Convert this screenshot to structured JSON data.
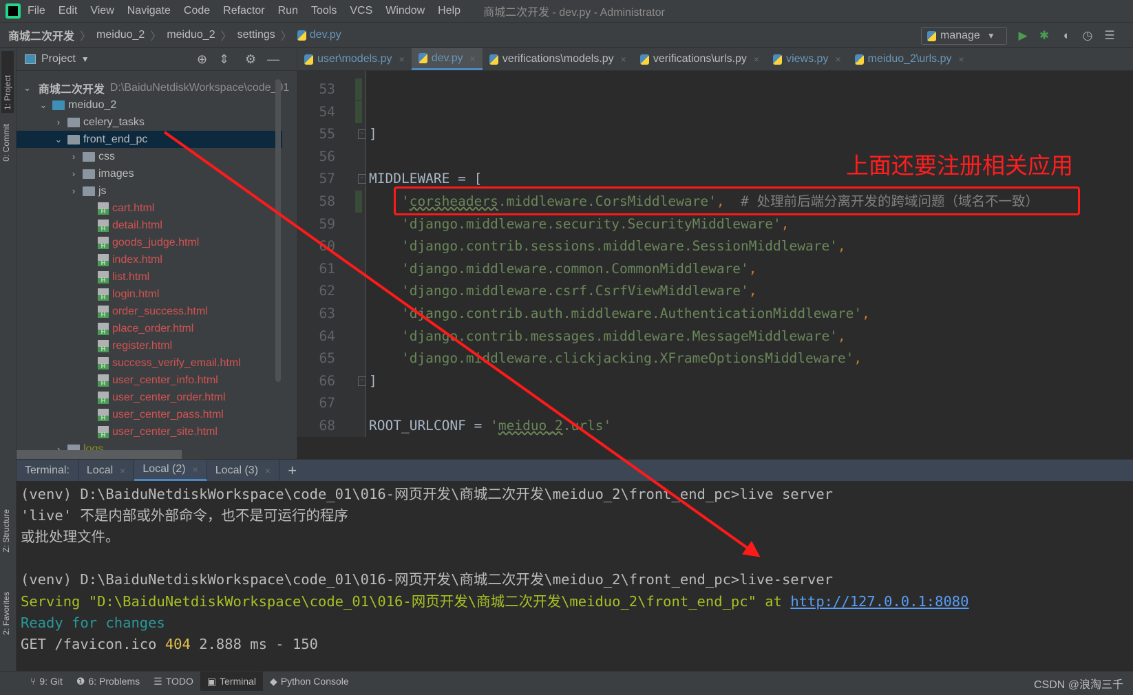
{
  "window": {
    "title": "商城二次开发 - dev.py - Administrator"
  },
  "menu": [
    "File",
    "Edit",
    "View",
    "Navigate",
    "Code",
    "Refactor",
    "Run",
    "Tools",
    "VCS",
    "Window",
    "Help"
  ],
  "breadcrumb": [
    "商城二次开发",
    "meiduo_2",
    "meiduo_2",
    "settings",
    "dev.py"
  ],
  "run_config": {
    "label": "manage",
    "icons": [
      "run-icon",
      "debug-icon",
      "coverage-icon",
      "profile-icon",
      "build-icon"
    ]
  },
  "left_strip": [
    "1: Project",
    "0: Commit",
    "Z: Structure",
    "2: Favorites"
  ],
  "project": {
    "header": "Project",
    "tree": [
      {
        "label": "商城二次开发",
        "suffix": "D:\\BaiduNetdiskWorkspace\\code_01",
        "depth": 0,
        "kind": "folder",
        "expanded": true,
        "color": "#bbbbbb"
      },
      {
        "label": "meiduo_2",
        "depth": 1,
        "kind": "folder-blue",
        "expanded": true,
        "color": "#bbbbbb"
      },
      {
        "label": "celery_tasks",
        "depth": 2,
        "kind": "folder",
        "expanded": false,
        "color": "#bbbbbb"
      },
      {
        "label": "front_end_pc",
        "depth": 2,
        "kind": "folder",
        "expanded": true,
        "color": "#bbbbbb",
        "selected": true
      },
      {
        "label": "css",
        "depth": 3,
        "kind": "folder",
        "expanded": false,
        "color": "#bbbbbb"
      },
      {
        "label": "images",
        "depth": 3,
        "kind": "folder",
        "expanded": false,
        "color": "#bbbbbb"
      },
      {
        "label": "js",
        "depth": 3,
        "kind": "folder",
        "expanded": false,
        "color": "#bbbbbb"
      },
      {
        "label": "cart.html",
        "depth": 4,
        "kind": "html",
        "color": "#d25252"
      },
      {
        "label": "detail.html",
        "depth": 4,
        "kind": "html",
        "color": "#d25252"
      },
      {
        "label": "goods_judge.html",
        "depth": 4,
        "kind": "html",
        "color": "#d25252"
      },
      {
        "label": "index.html",
        "depth": 4,
        "kind": "html",
        "color": "#d25252"
      },
      {
        "label": "list.html",
        "depth": 4,
        "kind": "html",
        "color": "#d25252"
      },
      {
        "label": "login.html",
        "depth": 4,
        "kind": "html",
        "color": "#d25252"
      },
      {
        "label": "order_success.html",
        "depth": 4,
        "kind": "html",
        "color": "#d25252"
      },
      {
        "label": "place_order.html",
        "depth": 4,
        "kind": "html",
        "color": "#d25252"
      },
      {
        "label": "register.html",
        "depth": 4,
        "kind": "html",
        "color": "#d25252"
      },
      {
        "label": "success_verify_email.html",
        "depth": 4,
        "kind": "html",
        "color": "#d25252"
      },
      {
        "label": "user_center_info.html",
        "depth": 4,
        "kind": "html",
        "color": "#d25252"
      },
      {
        "label": "user_center_order.html",
        "depth": 4,
        "kind": "html",
        "color": "#d25252"
      },
      {
        "label": "user_center_pass.html",
        "depth": 4,
        "kind": "html",
        "color": "#d25252"
      },
      {
        "label": "user_center_site.html",
        "depth": 4,
        "kind": "html",
        "color": "#d25252"
      },
      {
        "label": "logs",
        "depth": 2,
        "kind": "folder",
        "expanded": false,
        "color": "#8c8c1a"
      }
    ]
  },
  "editor_tabs": [
    {
      "label": "user\\models.py",
      "blue": true
    },
    {
      "label": "dev.py",
      "blue": true,
      "active": true
    },
    {
      "label": "verifications\\models.py"
    },
    {
      "label": "verifications\\urls.py"
    },
    {
      "label": "views.py",
      "blue": true
    },
    {
      "label": "meiduo_2\\urls.py",
      "blue": true
    }
  ],
  "code": [
    {
      "n": "53",
      "tokens": [],
      "changed": true
    },
    {
      "n": "54",
      "tokens": [],
      "changed": true
    },
    {
      "n": "55",
      "tokens": [
        {
          "t": "]",
          "k": "text"
        }
      ],
      "fold": true
    },
    {
      "n": "56",
      "tokens": []
    },
    {
      "n": "57",
      "tokens": [
        {
          "t": "MIDDLEWARE = [",
          "k": "text"
        }
      ],
      "fold": true
    },
    {
      "n": "58",
      "changed": true,
      "tokens": [
        {
          "t": "    '",
          "k": "string"
        },
        {
          "t": "corsheaders",
          "k": "string",
          "squiggle": true
        },
        {
          "t": ".middleware.CorsMiddleware'",
          "k": "string"
        },
        {
          "t": ",",
          "k": "punct"
        },
        {
          "t": "  # 处理前后端分离开发的跨域问题（域名不一致）",
          "k": "comment"
        }
      ]
    },
    {
      "n": "59",
      "tokens": [
        {
          "t": "    'django.middleware.security.SecurityMiddleware'",
          "k": "string"
        },
        {
          "t": ",",
          "k": "punct"
        }
      ]
    },
    {
      "n": "60",
      "tokens": [
        {
          "t": "    'django.contrib.sessions.middleware.SessionMiddleware'",
          "k": "string"
        },
        {
          "t": ",",
          "k": "punct"
        }
      ]
    },
    {
      "n": "61",
      "tokens": [
        {
          "t": "    'django.middleware.common.CommonMiddleware'",
          "k": "string"
        },
        {
          "t": ",",
          "k": "punct"
        }
      ]
    },
    {
      "n": "62",
      "tokens": [
        {
          "t": "    'django.middleware.csrf.CsrfViewMiddleware'",
          "k": "string"
        },
        {
          "t": ",",
          "k": "punct"
        }
      ]
    },
    {
      "n": "63",
      "tokens": [
        {
          "t": "    'django.contrib.auth.middleware.AuthenticationMiddleware'",
          "k": "string"
        },
        {
          "t": ",",
          "k": "punct"
        }
      ]
    },
    {
      "n": "64",
      "tokens": [
        {
          "t": "    'django.contrib.messages.middleware.MessageMiddleware'",
          "k": "string"
        },
        {
          "t": ",",
          "k": "punct"
        }
      ]
    },
    {
      "n": "65",
      "tokens": [
        {
          "t": "    'django.middleware.clickjacking.XFrameOptionsMiddleware'",
          "k": "string"
        },
        {
          "t": ",",
          "k": "punct"
        }
      ]
    },
    {
      "n": "66",
      "tokens": [
        {
          "t": "]",
          "k": "text"
        }
      ],
      "fold": true
    },
    {
      "n": "67",
      "tokens": []
    },
    {
      "n": "68",
      "tokens": [
        {
          "t": "ROOT_URLCONF = ",
          "k": "text"
        },
        {
          "t": "'",
          "k": "string"
        },
        {
          "t": "meiduo_2",
          "k": "string",
          "squiggle": true
        },
        {
          "t": ".urls'",
          "k": "string"
        }
      ]
    }
  ],
  "annotation": {
    "text": "上面还要注册相关应用",
    "color": "#ff1e1e"
  },
  "terminal": {
    "label": "Terminal:",
    "tabs": [
      {
        "label": "Local"
      },
      {
        "label": "Local (2)",
        "active": true
      },
      {
        "label": "Local (3)"
      }
    ],
    "add_label": "+",
    "lines": [
      [
        {
          "t": "(venv) D:\\BaiduNetdiskWorkspace\\code_01\\016-网页开发\\商城二次开发\\meiduo_2\\front_end_pc>live server",
          "k": "plain"
        }
      ],
      [
        {
          "t": "'live' 不是内部或外部命令，也不是可运行的程序",
          "k": "plain"
        }
      ],
      [
        {
          "t": "或批处理文件。",
          "k": "plain"
        }
      ],
      [],
      [
        {
          "t": "(venv) D:\\BaiduNetdiskWorkspace\\code_01\\016-网页开发\\商城二次开发\\meiduo_2\\front_end_pc>live-server",
          "k": "plain"
        }
      ],
      [
        {
          "t": "Serving \"D:\\BaiduNetdiskWorkspace\\code_01\\016-网页开发\\商城二次开发\\meiduo_2\\front_end_pc\" at ",
          "k": "serve"
        },
        {
          "t": "http://127.0.0.1:8080",
          "k": "link"
        }
      ],
      [
        {
          "t": "Ready for changes",
          "k": "ready"
        }
      ],
      [
        {
          "t": "GET /favicon.ico ",
          "k": "plain"
        },
        {
          "t": "404",
          "k": "warn"
        },
        {
          "t": " 2.888 ms - 150",
          "k": "plain"
        }
      ]
    ]
  },
  "bottom_tools": [
    {
      "label": "9: Git",
      "icon": "git-branch-icon"
    },
    {
      "label": "6: Problems",
      "icon": "problems-icon"
    },
    {
      "label": "TODO",
      "icon": "todo-icon"
    },
    {
      "label": "Terminal",
      "icon": "terminal-icon",
      "active": true
    },
    {
      "label": "Python Console",
      "icon": "python-icon"
    }
  ],
  "watermark": "CSDN @浪淘三千"
}
